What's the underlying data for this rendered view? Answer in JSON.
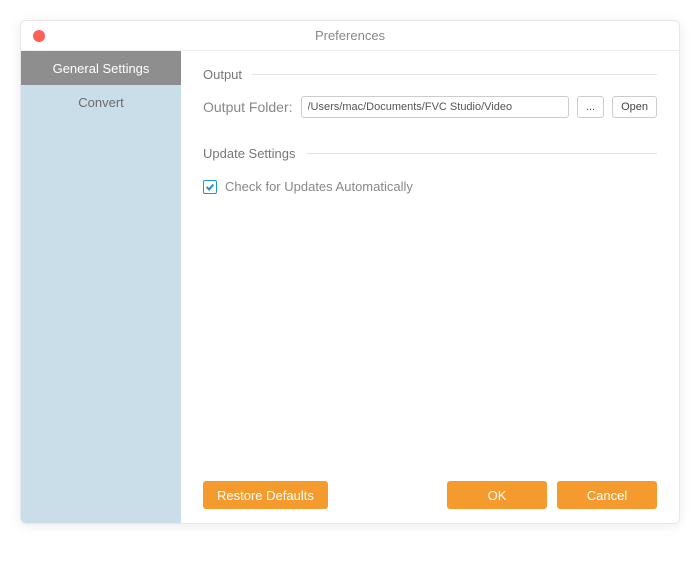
{
  "window": {
    "title": "Preferences"
  },
  "sidebar": {
    "items": [
      {
        "label": "General Settings"
      },
      {
        "label": "Convert"
      }
    ]
  },
  "sections": {
    "output": {
      "title": "Output",
      "folder_label": "Output Folder:",
      "folder_value": "/Users/mac/Documents/FVC Studio/Video",
      "browse_label": "...",
      "open_label": "Open"
    },
    "update": {
      "title": "Update Settings",
      "checkbox_label": "Check for Updates Automatically",
      "checked": true
    }
  },
  "footer": {
    "restore_label": "Restore Defaults",
    "ok_label": "OK",
    "cancel_label": "Cancel"
  }
}
